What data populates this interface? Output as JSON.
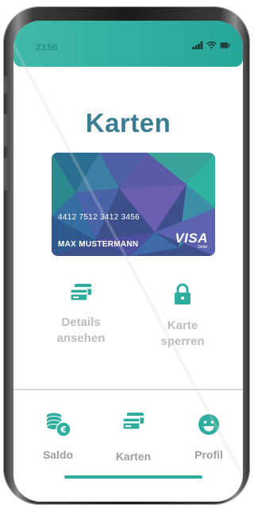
{
  "status_bar": {
    "time": "23:56"
  },
  "page": {
    "title": "Karten"
  },
  "card": {
    "number": "4412 7512 3412 3456",
    "holder": "MAX MUSTERMANN",
    "brand": "VISA",
    "brand_sub": "Debit"
  },
  "actions": [
    {
      "label_line1": "Details",
      "label_line2": "ansehen",
      "icon": "cards-icon"
    },
    {
      "label_line1": "Karte",
      "label_line2": "sperren",
      "icon": "lock-icon"
    }
  ],
  "nav": [
    {
      "label": "Saldo",
      "icon": "coins-euro-icon"
    },
    {
      "label": "Karten",
      "icon": "cards-icon"
    },
    {
      "label": "Profil",
      "icon": "smiley-icon"
    }
  ],
  "colors": {
    "accent": "#2fae9f",
    "title": "#3b7d93",
    "muted_text": "#bdbdbd"
  }
}
